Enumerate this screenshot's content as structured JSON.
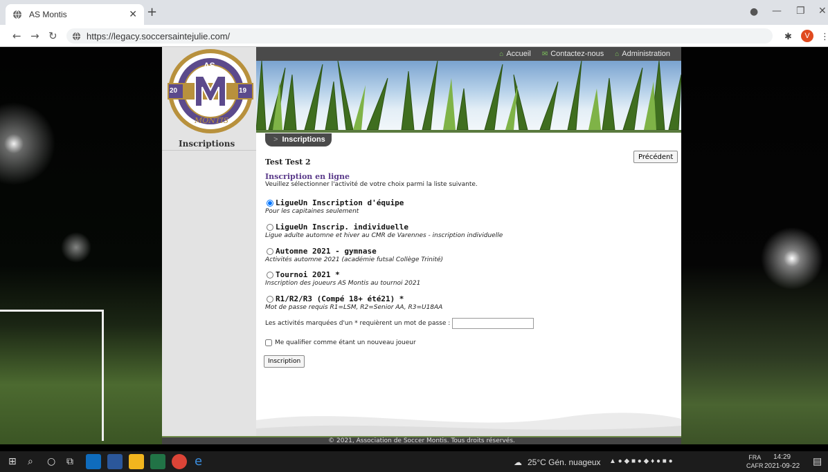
{
  "browser": {
    "tab_title": "AS Montis",
    "url": "https://legacy.soccersaintejulie.com/",
    "profile_initial": "V"
  },
  "site": {
    "logo": {
      "top_text": "AS",
      "letter": "M",
      "year_left": "20",
      "year_right": "19",
      "bottom_text": "MONTIS",
      "colors": {
        "gold": "#b8913d",
        "purple": "#5c4a8c"
      }
    },
    "sidebar_item": "Inscriptions",
    "topnav": {
      "home": "Accueil",
      "contact": "Contactez-nous",
      "admin": "Administration"
    },
    "section_pill": "Inscriptions",
    "prev_button": "Précédent",
    "user_name": "Test Test 2",
    "heading": "Inscription en ligne",
    "subheading": "Veuillez sélectionner l'activité de votre choix parmi la liste suivante.",
    "options": [
      {
        "label": "LigueUn Inscription d'équipe",
        "desc": "Pour les capitaines seulement",
        "checked": true
      },
      {
        "label": "LigueUn Inscrip. individuelle",
        "desc": "Ligue adulte automne et hiver au CMR de Varennes - inscription individuelle",
        "checked": false
      },
      {
        "label": "Automne 2021 - gymnase",
        "desc": "Activités automne 2021 (académie futsal Collège Trinité)",
        "checked": false
      },
      {
        "label": "Tournoi 2021 *",
        "desc": "Inscription des joueurs AS Montis au tournoi 2021",
        "checked": false
      },
      {
        "label": "R1/R2/R3 (Compé 18+ été21) *",
        "desc": "Mot de passe requis R1=LSM, R2=Senior AA, R3=U18AA",
        "checked": false
      }
    ],
    "password_label": "Les activités marquées d'un * requièrent un mot de passe :",
    "password_value": "",
    "new_player_label": "Me qualifier comme étant un nouveau joueur",
    "submit_label": "Inscription",
    "footer": "© 2021, Association de Soccer Montis. Tous droits réservés."
  },
  "taskbar": {
    "weather": "25°C Gén. nuageux",
    "lang_top": "FRA",
    "lang_bottom": "CAFR",
    "time": "14:29",
    "date": "2021-09-22"
  }
}
